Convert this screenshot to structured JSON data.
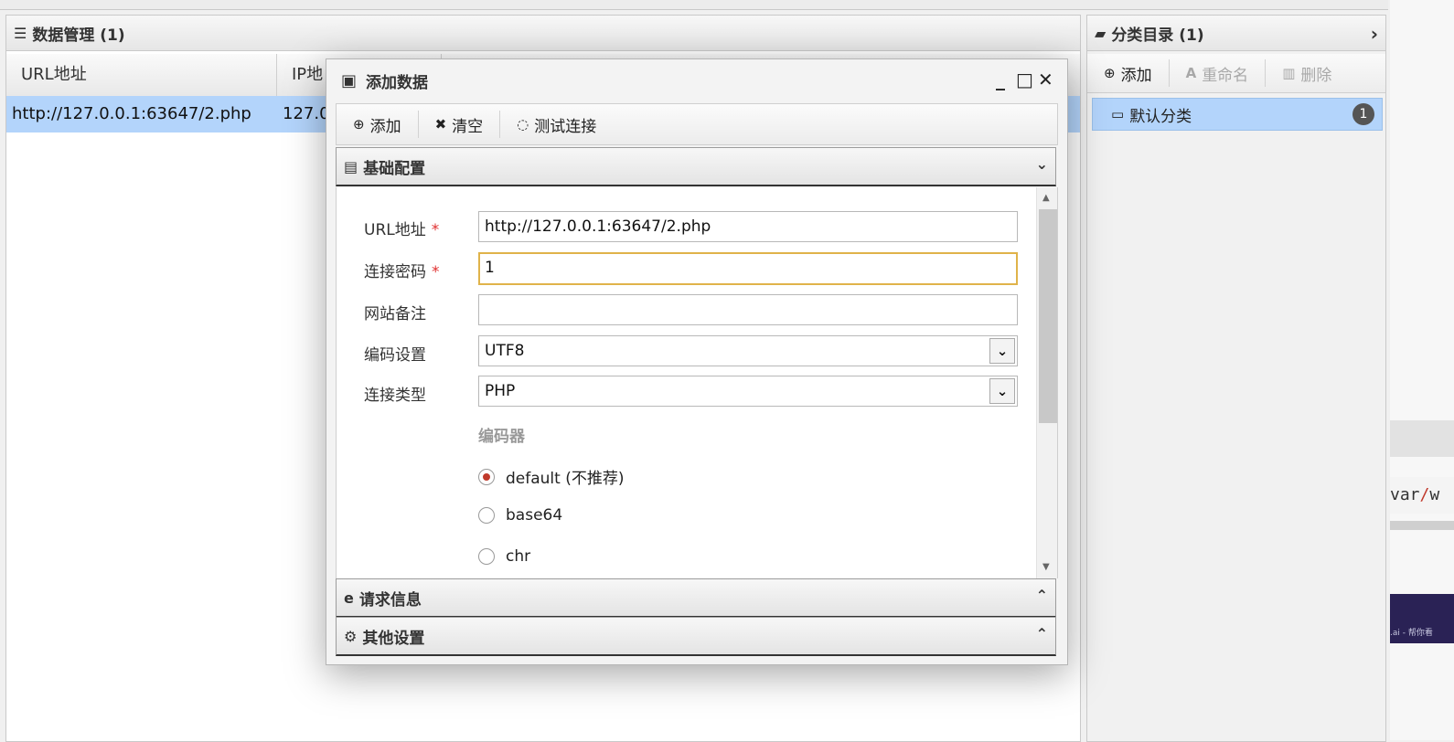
{
  "data_panel": {
    "title": "数据管理 (1)",
    "columns": [
      "URL地址",
      "IP地"
    ],
    "rows": [
      {
        "url": "http://127.0.0.1:63647/2.php",
        "ip": "127.0"
      }
    ]
  },
  "category_panel": {
    "title": "分类目录 (1)",
    "toolbar": {
      "add": "添加",
      "rename": "重命名",
      "delete": "删除"
    },
    "items": [
      {
        "label": "默认分类",
        "count": "1"
      }
    ]
  },
  "background": {
    "code_prefix": "var",
    "code_sep": "/",
    "code_suffix": "w",
    "ad_text": ".ai - 帮你看"
  },
  "dialog": {
    "title": "添加数据",
    "toolbar": {
      "add": "添加",
      "clear": "清空",
      "test": "测试连接"
    },
    "sections": {
      "basic": "基础配置",
      "request": "请求信息",
      "other": "其他设置"
    },
    "form": {
      "url_label": "URL地址",
      "url_value": "http://127.0.0.1:63647/2.php",
      "password_label": "连接密码",
      "password_value": "1",
      "note_label": "网站备注",
      "note_value": "",
      "required_mark": "*",
      "encoding_label": "编码设置",
      "encoding_value": "UTF8",
      "type_label": "连接类型",
      "type_value": "PHP",
      "encoder_title": "编码器",
      "encoders": [
        {
          "label": "default (不推荐)",
          "selected": true
        },
        {
          "label": "base64",
          "selected": false
        },
        {
          "label": "chr",
          "selected": false
        }
      ]
    }
  }
}
